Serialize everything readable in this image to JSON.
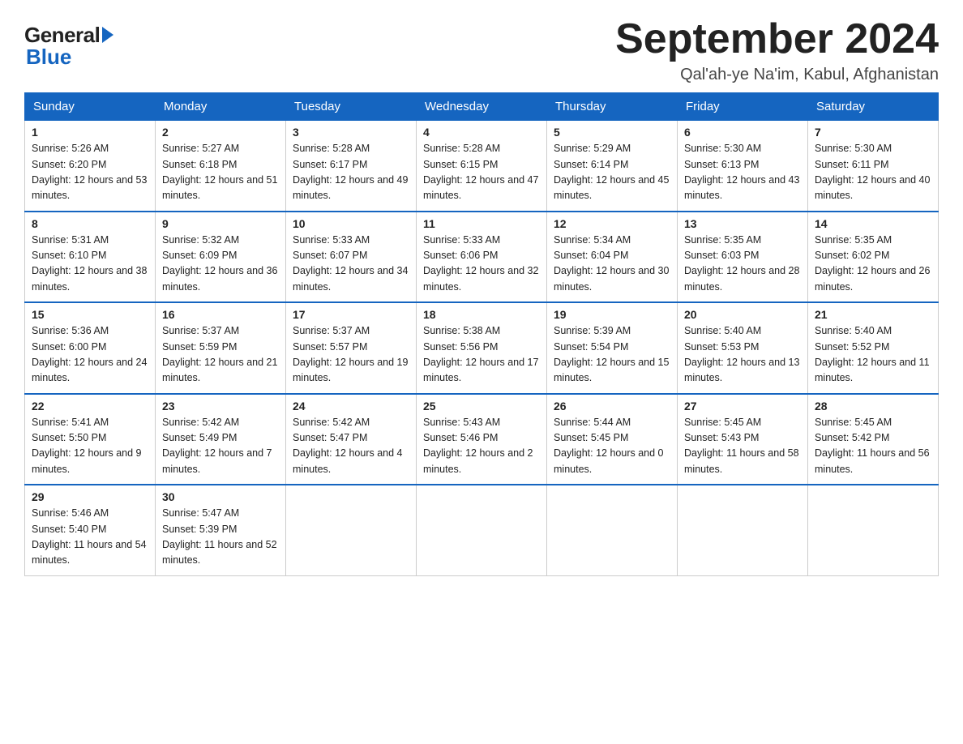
{
  "header": {
    "logo_general": "General",
    "logo_blue": "Blue",
    "month_title": "September 2024",
    "location": "Qal'ah-ye Na'im, Kabul, Afghanistan"
  },
  "weekdays": [
    "Sunday",
    "Monday",
    "Tuesday",
    "Wednesday",
    "Thursday",
    "Friday",
    "Saturday"
  ],
  "weeks": [
    [
      {
        "day": "1",
        "sunrise": "5:26 AM",
        "sunset": "6:20 PM",
        "daylight": "12 hours and 53 minutes."
      },
      {
        "day": "2",
        "sunrise": "5:27 AM",
        "sunset": "6:18 PM",
        "daylight": "12 hours and 51 minutes."
      },
      {
        "day": "3",
        "sunrise": "5:28 AM",
        "sunset": "6:17 PM",
        "daylight": "12 hours and 49 minutes."
      },
      {
        "day": "4",
        "sunrise": "5:28 AM",
        "sunset": "6:15 PM",
        "daylight": "12 hours and 47 minutes."
      },
      {
        "day": "5",
        "sunrise": "5:29 AM",
        "sunset": "6:14 PM",
        "daylight": "12 hours and 45 minutes."
      },
      {
        "day": "6",
        "sunrise": "5:30 AM",
        "sunset": "6:13 PM",
        "daylight": "12 hours and 43 minutes."
      },
      {
        "day": "7",
        "sunrise": "5:30 AM",
        "sunset": "6:11 PM",
        "daylight": "12 hours and 40 minutes."
      }
    ],
    [
      {
        "day": "8",
        "sunrise": "5:31 AM",
        "sunset": "6:10 PM",
        "daylight": "12 hours and 38 minutes."
      },
      {
        "day": "9",
        "sunrise": "5:32 AM",
        "sunset": "6:09 PM",
        "daylight": "12 hours and 36 minutes."
      },
      {
        "day": "10",
        "sunrise": "5:33 AM",
        "sunset": "6:07 PM",
        "daylight": "12 hours and 34 minutes."
      },
      {
        "day": "11",
        "sunrise": "5:33 AM",
        "sunset": "6:06 PM",
        "daylight": "12 hours and 32 minutes."
      },
      {
        "day": "12",
        "sunrise": "5:34 AM",
        "sunset": "6:04 PM",
        "daylight": "12 hours and 30 minutes."
      },
      {
        "day": "13",
        "sunrise": "5:35 AM",
        "sunset": "6:03 PM",
        "daylight": "12 hours and 28 minutes."
      },
      {
        "day": "14",
        "sunrise": "5:35 AM",
        "sunset": "6:02 PM",
        "daylight": "12 hours and 26 minutes."
      }
    ],
    [
      {
        "day": "15",
        "sunrise": "5:36 AM",
        "sunset": "6:00 PM",
        "daylight": "12 hours and 24 minutes."
      },
      {
        "day": "16",
        "sunrise": "5:37 AM",
        "sunset": "5:59 PM",
        "daylight": "12 hours and 21 minutes."
      },
      {
        "day": "17",
        "sunrise": "5:37 AM",
        "sunset": "5:57 PM",
        "daylight": "12 hours and 19 minutes."
      },
      {
        "day": "18",
        "sunrise": "5:38 AM",
        "sunset": "5:56 PM",
        "daylight": "12 hours and 17 minutes."
      },
      {
        "day": "19",
        "sunrise": "5:39 AM",
        "sunset": "5:54 PM",
        "daylight": "12 hours and 15 minutes."
      },
      {
        "day": "20",
        "sunrise": "5:40 AM",
        "sunset": "5:53 PM",
        "daylight": "12 hours and 13 minutes."
      },
      {
        "day": "21",
        "sunrise": "5:40 AM",
        "sunset": "5:52 PM",
        "daylight": "12 hours and 11 minutes."
      }
    ],
    [
      {
        "day": "22",
        "sunrise": "5:41 AM",
        "sunset": "5:50 PM",
        "daylight": "12 hours and 9 minutes."
      },
      {
        "day": "23",
        "sunrise": "5:42 AM",
        "sunset": "5:49 PM",
        "daylight": "12 hours and 7 minutes."
      },
      {
        "day": "24",
        "sunrise": "5:42 AM",
        "sunset": "5:47 PM",
        "daylight": "12 hours and 4 minutes."
      },
      {
        "day": "25",
        "sunrise": "5:43 AM",
        "sunset": "5:46 PM",
        "daylight": "12 hours and 2 minutes."
      },
      {
        "day": "26",
        "sunrise": "5:44 AM",
        "sunset": "5:45 PM",
        "daylight": "12 hours and 0 minutes."
      },
      {
        "day": "27",
        "sunrise": "5:45 AM",
        "sunset": "5:43 PM",
        "daylight": "11 hours and 58 minutes."
      },
      {
        "day": "28",
        "sunrise": "5:45 AM",
        "sunset": "5:42 PM",
        "daylight": "11 hours and 56 minutes."
      }
    ],
    [
      {
        "day": "29",
        "sunrise": "5:46 AM",
        "sunset": "5:40 PM",
        "daylight": "11 hours and 54 minutes."
      },
      {
        "day": "30",
        "sunrise": "5:47 AM",
        "sunset": "5:39 PM",
        "daylight": "11 hours and 52 minutes."
      },
      null,
      null,
      null,
      null,
      null
    ]
  ]
}
